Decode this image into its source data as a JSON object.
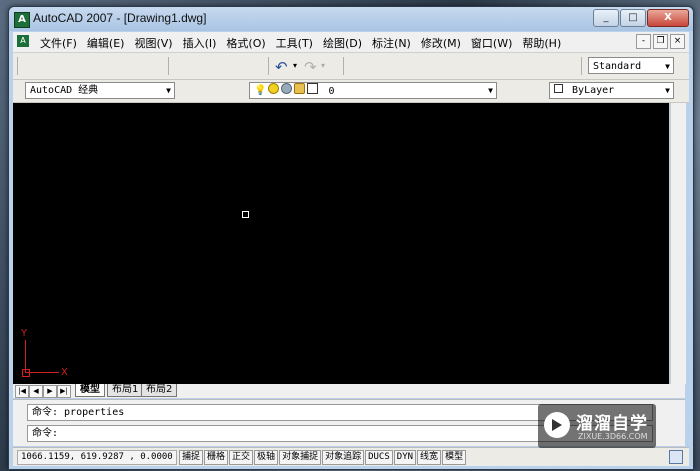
{
  "window": {
    "title": "AutoCAD 2007 - [Drawing1.dwg]",
    "min": "_",
    "max": "□",
    "close": "X"
  },
  "menubar": {
    "items": [
      "文件(F)",
      "编辑(E)",
      "视图(V)",
      "插入(I)",
      "格式(O)",
      "工具(T)",
      "绘图(D)",
      "标注(N)",
      "修改(M)",
      "窗口(W)",
      "帮助(H)"
    ],
    "doc_min": "-",
    "doc_restore": "❐",
    "doc_close": "×"
  },
  "toolbar": {
    "text_style": "Standard",
    "workspace": "AutoCAD 经典",
    "layer_value": "0",
    "color_value": "ByLayer"
  },
  "ucs": {
    "y": "Y",
    "x": "X"
  },
  "tabs": {
    "items": [
      "模型",
      "布局1",
      "布局2"
    ],
    "active": "模型"
  },
  "command": {
    "history": "命令: properties",
    "prompt": "命令:"
  },
  "status": {
    "coords": "1066.1159, 619.9287 , 0.0000",
    "buttons": [
      "捕捉",
      "栅格",
      "正交",
      "极轴",
      "对象捕捉",
      "对象追踪",
      "DUCS",
      "DYN",
      "线宽",
      "模型"
    ]
  },
  "watermark": {
    "title": "溜溜自学",
    "url": "ZIXUE.3D66.COM"
  },
  "colors": {
    "canvas": "#000000",
    "ucs": "#d02020",
    "titlebar": "#b9d1ea"
  }
}
